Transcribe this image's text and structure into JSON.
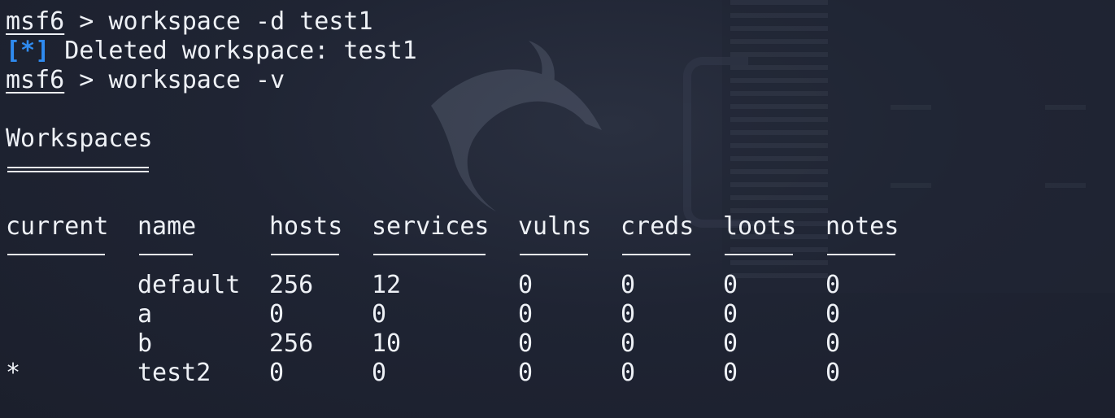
{
  "terminal": {
    "line1": {
      "prompt": "msf6",
      "sep": " > ",
      "cmd": "workspace -d test1"
    },
    "line2": {
      "marker": "[*]",
      "text": " Deleted workspace: test1"
    },
    "line3": {
      "prompt": "msf6",
      "sep": " > ",
      "cmd": "workspace -v"
    },
    "heading": "Workspaces",
    "columns": [
      "current",
      "name",
      "hosts",
      "services",
      "vulns",
      "creds",
      "loots",
      "notes"
    ],
    "rows": [
      [
        "",
        "default",
        "256",
        "12",
        "0",
        "0",
        "0",
        "0"
      ],
      [
        "",
        "a",
        "0",
        "0",
        "0",
        "0",
        "0",
        "0"
      ],
      [
        "",
        "b",
        "256",
        "10",
        "0",
        "0",
        "0",
        "0"
      ],
      [
        "*",
        "test2",
        "0",
        "0",
        "0",
        "0",
        "0",
        "0"
      ]
    ]
  },
  "colors": {
    "background": "#1e2331",
    "text": "#eef1f6",
    "marker": "#2f8bf0"
  }
}
